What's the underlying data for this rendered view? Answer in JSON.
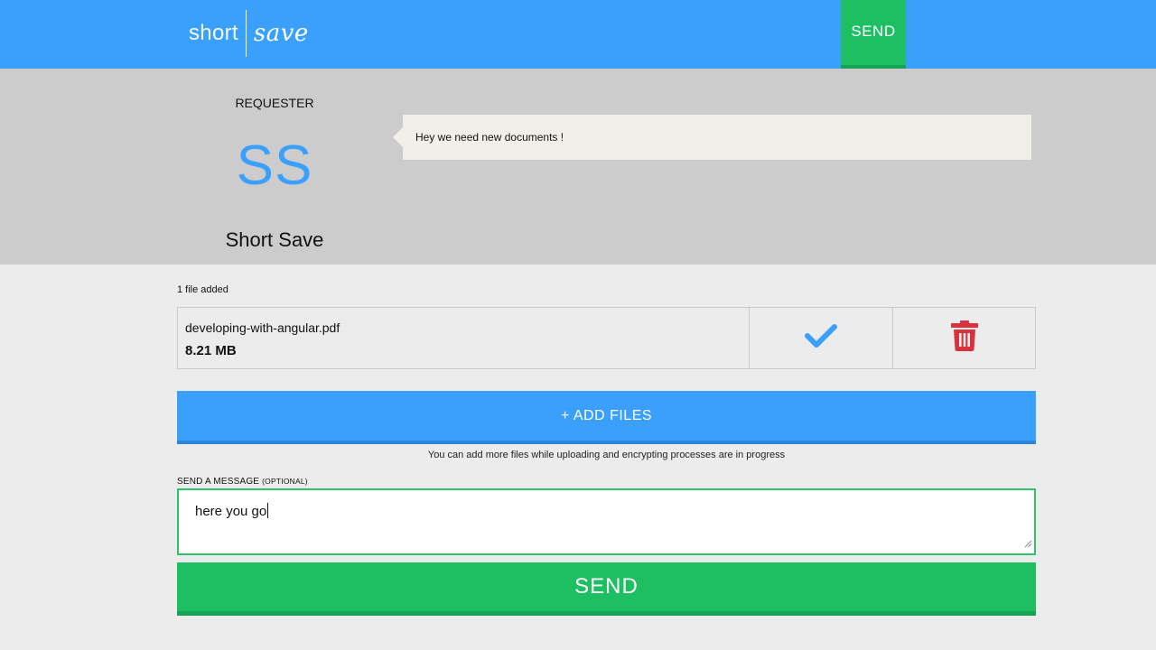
{
  "header": {
    "logo_short": "short",
    "logo_save": "save",
    "send_label": "SEND"
  },
  "requester": {
    "label": "REQUESTER",
    "initials": "SS",
    "name": "Short Save",
    "message": "Hey we need new documents !"
  },
  "files": {
    "count_text": "1 file added",
    "items": [
      {
        "name": "developing-with-angular.pdf",
        "size": "8.21 MB",
        "status_icon": "check-icon",
        "delete_icon": "trash-icon"
      }
    ],
    "add_label": "+ ADD FILES",
    "hint": "You can add more files while uploading and encrypting processes are in progress"
  },
  "message": {
    "label": "SEND A MESSAGE",
    "optional": "(OPTIONAL)",
    "value": "here you go"
  },
  "send_button": {
    "label": "SEND"
  },
  "colors": {
    "primary_blue": "#3ba0fb",
    "send_green": "#1dbf62",
    "delete_red": "#d9323c",
    "band_gray": "#cccccc"
  }
}
